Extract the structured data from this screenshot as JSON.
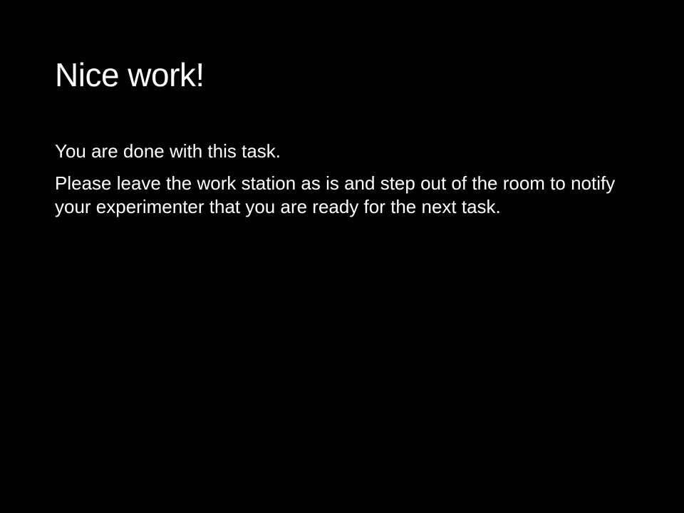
{
  "slide": {
    "title": "Nice work!",
    "paragraphs": [
      "You are done with this task.",
      "Please leave the work station as is and step out of the room to notify your experimenter that you are ready for the next task."
    ]
  },
  "colors": {
    "background": "#000000",
    "text": "#ffffff"
  }
}
